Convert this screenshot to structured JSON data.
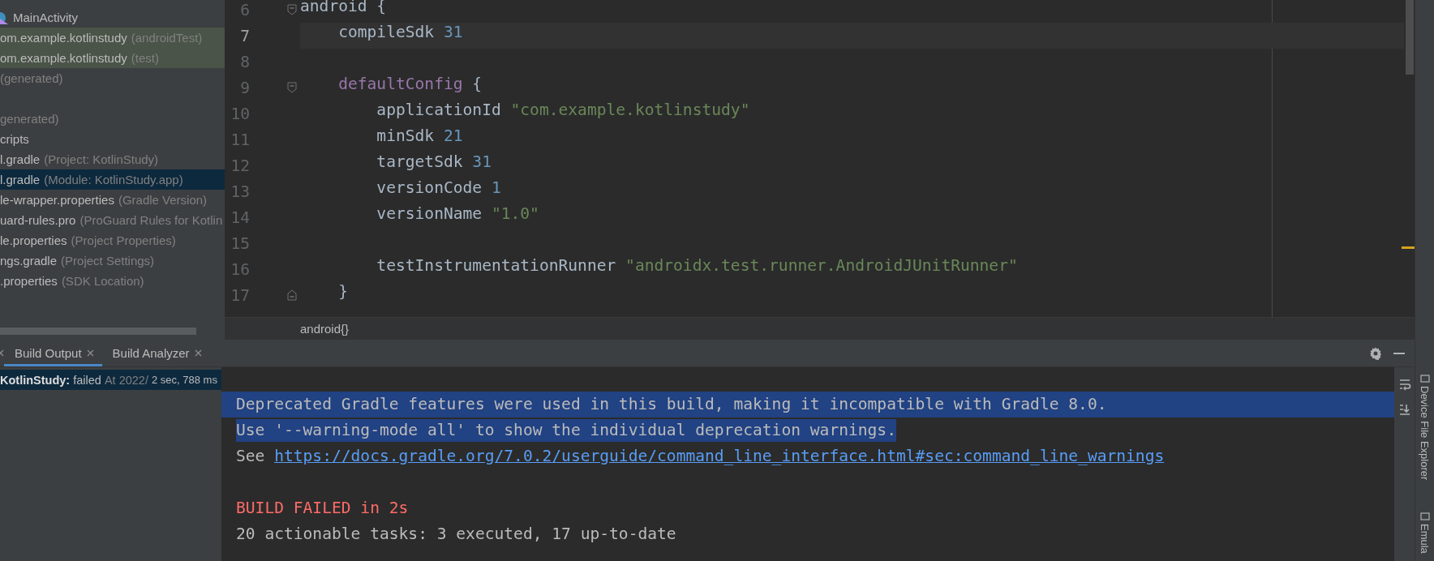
{
  "project_tree": {
    "items": [
      {
        "kind": "class",
        "name": "MainActivity",
        "selected": false,
        "test_scope": false
      },
      {
        "kind": "entry",
        "name": "om.example.kotlinstudy",
        "hint": "(androidTest)",
        "selected": false,
        "test_scope": true
      },
      {
        "kind": "entry",
        "name": "om.example.kotlinstudy",
        "hint": "(test)",
        "selected": false,
        "test_scope": true
      },
      {
        "kind": "entry",
        "hint": "(generated)",
        "selected": false,
        "test_scope": false
      },
      {
        "kind": "gap"
      },
      {
        "kind": "entry",
        "hint": "generated)",
        "selected": false,
        "test_scope": false
      },
      {
        "kind": "entry",
        "name": "cripts",
        "selected": false,
        "test_scope": false
      },
      {
        "kind": "entry",
        "name": "l.gradle",
        "hint": "(Project: KotlinStudy)",
        "selected": false,
        "test_scope": false
      },
      {
        "kind": "entry",
        "name": "l.gradle",
        "hint": "(Module: KotlinStudy.app)",
        "selected": true,
        "test_scope": false
      },
      {
        "kind": "entry",
        "name": "le-wrapper.properties",
        "hint": "(Gradle Version)",
        "selected": false,
        "test_scope": false
      },
      {
        "kind": "entry",
        "name": "uard-rules.pro",
        "hint": "(ProGuard Rules for Kotlin",
        "selected": false,
        "test_scope": false
      },
      {
        "kind": "entry",
        "name": "le.properties",
        "hint": "(Project Properties)",
        "selected": false,
        "test_scope": false
      },
      {
        "kind": "entry",
        "name": "ngs.gradle",
        "hint": "(Project Settings)",
        "selected": false,
        "test_scope": false
      },
      {
        "kind": "entry",
        "name": ".properties",
        "hint": "(SDK Location)",
        "selected": false,
        "test_scope": false
      }
    ]
  },
  "editor": {
    "lines": [
      {
        "number": "6",
        "current": false,
        "fold_start": true,
        "tokens": [
          {
            "kind": "plain",
            "text": "android {"
          }
        ]
      },
      {
        "number": "7",
        "current": true,
        "tokens": [
          {
            "kind": "plain",
            "text": "    compileSdk "
          },
          {
            "kind": "number",
            "text": "31"
          }
        ]
      },
      {
        "number": "8",
        "current": false
      },
      {
        "number": "9",
        "current": false,
        "fold_start": true,
        "tokens": [
          {
            "kind": "keyword",
            "text": "    defaultConfig"
          },
          {
            "kind": "plain",
            "text": " {"
          }
        ]
      },
      {
        "number": "10",
        "current": false,
        "tokens": [
          {
            "kind": "plain",
            "text": "        applicationId "
          },
          {
            "kind": "string",
            "text": "\"com.example.kotlinstudy\""
          }
        ]
      },
      {
        "number": "11",
        "current": false,
        "tokens": [
          {
            "kind": "plain",
            "text": "        minSdk "
          },
          {
            "kind": "number",
            "text": "21"
          }
        ]
      },
      {
        "number": "12",
        "current": false,
        "tokens": [
          {
            "kind": "plain",
            "text": "        targetSdk "
          },
          {
            "kind": "number",
            "text": "31"
          }
        ]
      },
      {
        "number": "13",
        "current": false,
        "tokens": [
          {
            "kind": "plain",
            "text": "        versionCode "
          },
          {
            "kind": "number",
            "text": "1"
          }
        ]
      },
      {
        "number": "14",
        "current": false,
        "tokens": [
          {
            "kind": "plain",
            "text": "        versionName "
          },
          {
            "kind": "string",
            "text": "\"1.0\""
          }
        ]
      },
      {
        "number": "15",
        "current": false
      },
      {
        "number": "16",
        "current": false,
        "tokens": [
          {
            "kind": "plain",
            "text": "        testInstrumentationRunner "
          },
          {
            "kind": "string",
            "text": "\"androidx.test.runner.AndroidJUnitRunner\""
          }
        ]
      },
      {
        "number": "17",
        "current": false,
        "fold_end": true,
        "tokens": [
          {
            "kind": "plain",
            "text": "    }"
          }
        ]
      }
    ],
    "breadcrumb": "android{}"
  },
  "build_panel": {
    "tabs": [
      {
        "label": "Build Output",
        "selected": true
      },
      {
        "label": "Build Analyzer",
        "selected": false
      }
    ],
    "tree": {
      "project": "KotlinStudy:",
      "status": "failed",
      "started": "At 2022/",
      "duration": "2 sec, 788 ms",
      "selected": true
    },
    "console": [
      {
        "kind": "text",
        "selected": true,
        "segments": [
          {
            "kind": "plain",
            "text": "Deprecated Gradle features were used in this build, making it incompatible with Gradle 8.0."
          }
        ]
      },
      {
        "kind": "text",
        "selected": true,
        "segments": [
          {
            "kind": "plain",
            "text": "Use '--warning-mode all' to show the individual deprecation warnings."
          }
        ]
      },
      {
        "kind": "text",
        "selected": false,
        "segments": [
          {
            "kind": "plain",
            "text": "See "
          },
          {
            "kind": "link",
            "text": "https://docs.gradle.org/7.0.2/userguide/command_line_interface.html#sec:command_line_warnings"
          }
        ]
      },
      {
        "kind": "blank"
      },
      {
        "kind": "text",
        "selected": false,
        "segments": [
          {
            "kind": "error",
            "text": "BUILD FAILED in 2s"
          }
        ]
      },
      {
        "kind": "text",
        "selected": false,
        "segments": [
          {
            "kind": "plain",
            "text": "20 actionable tasks: 3 executed, 17 up-to-date"
          }
        ]
      }
    ]
  },
  "side_stripe": {
    "items": [
      "Device File Explorer",
      "Emula"
    ]
  }
}
